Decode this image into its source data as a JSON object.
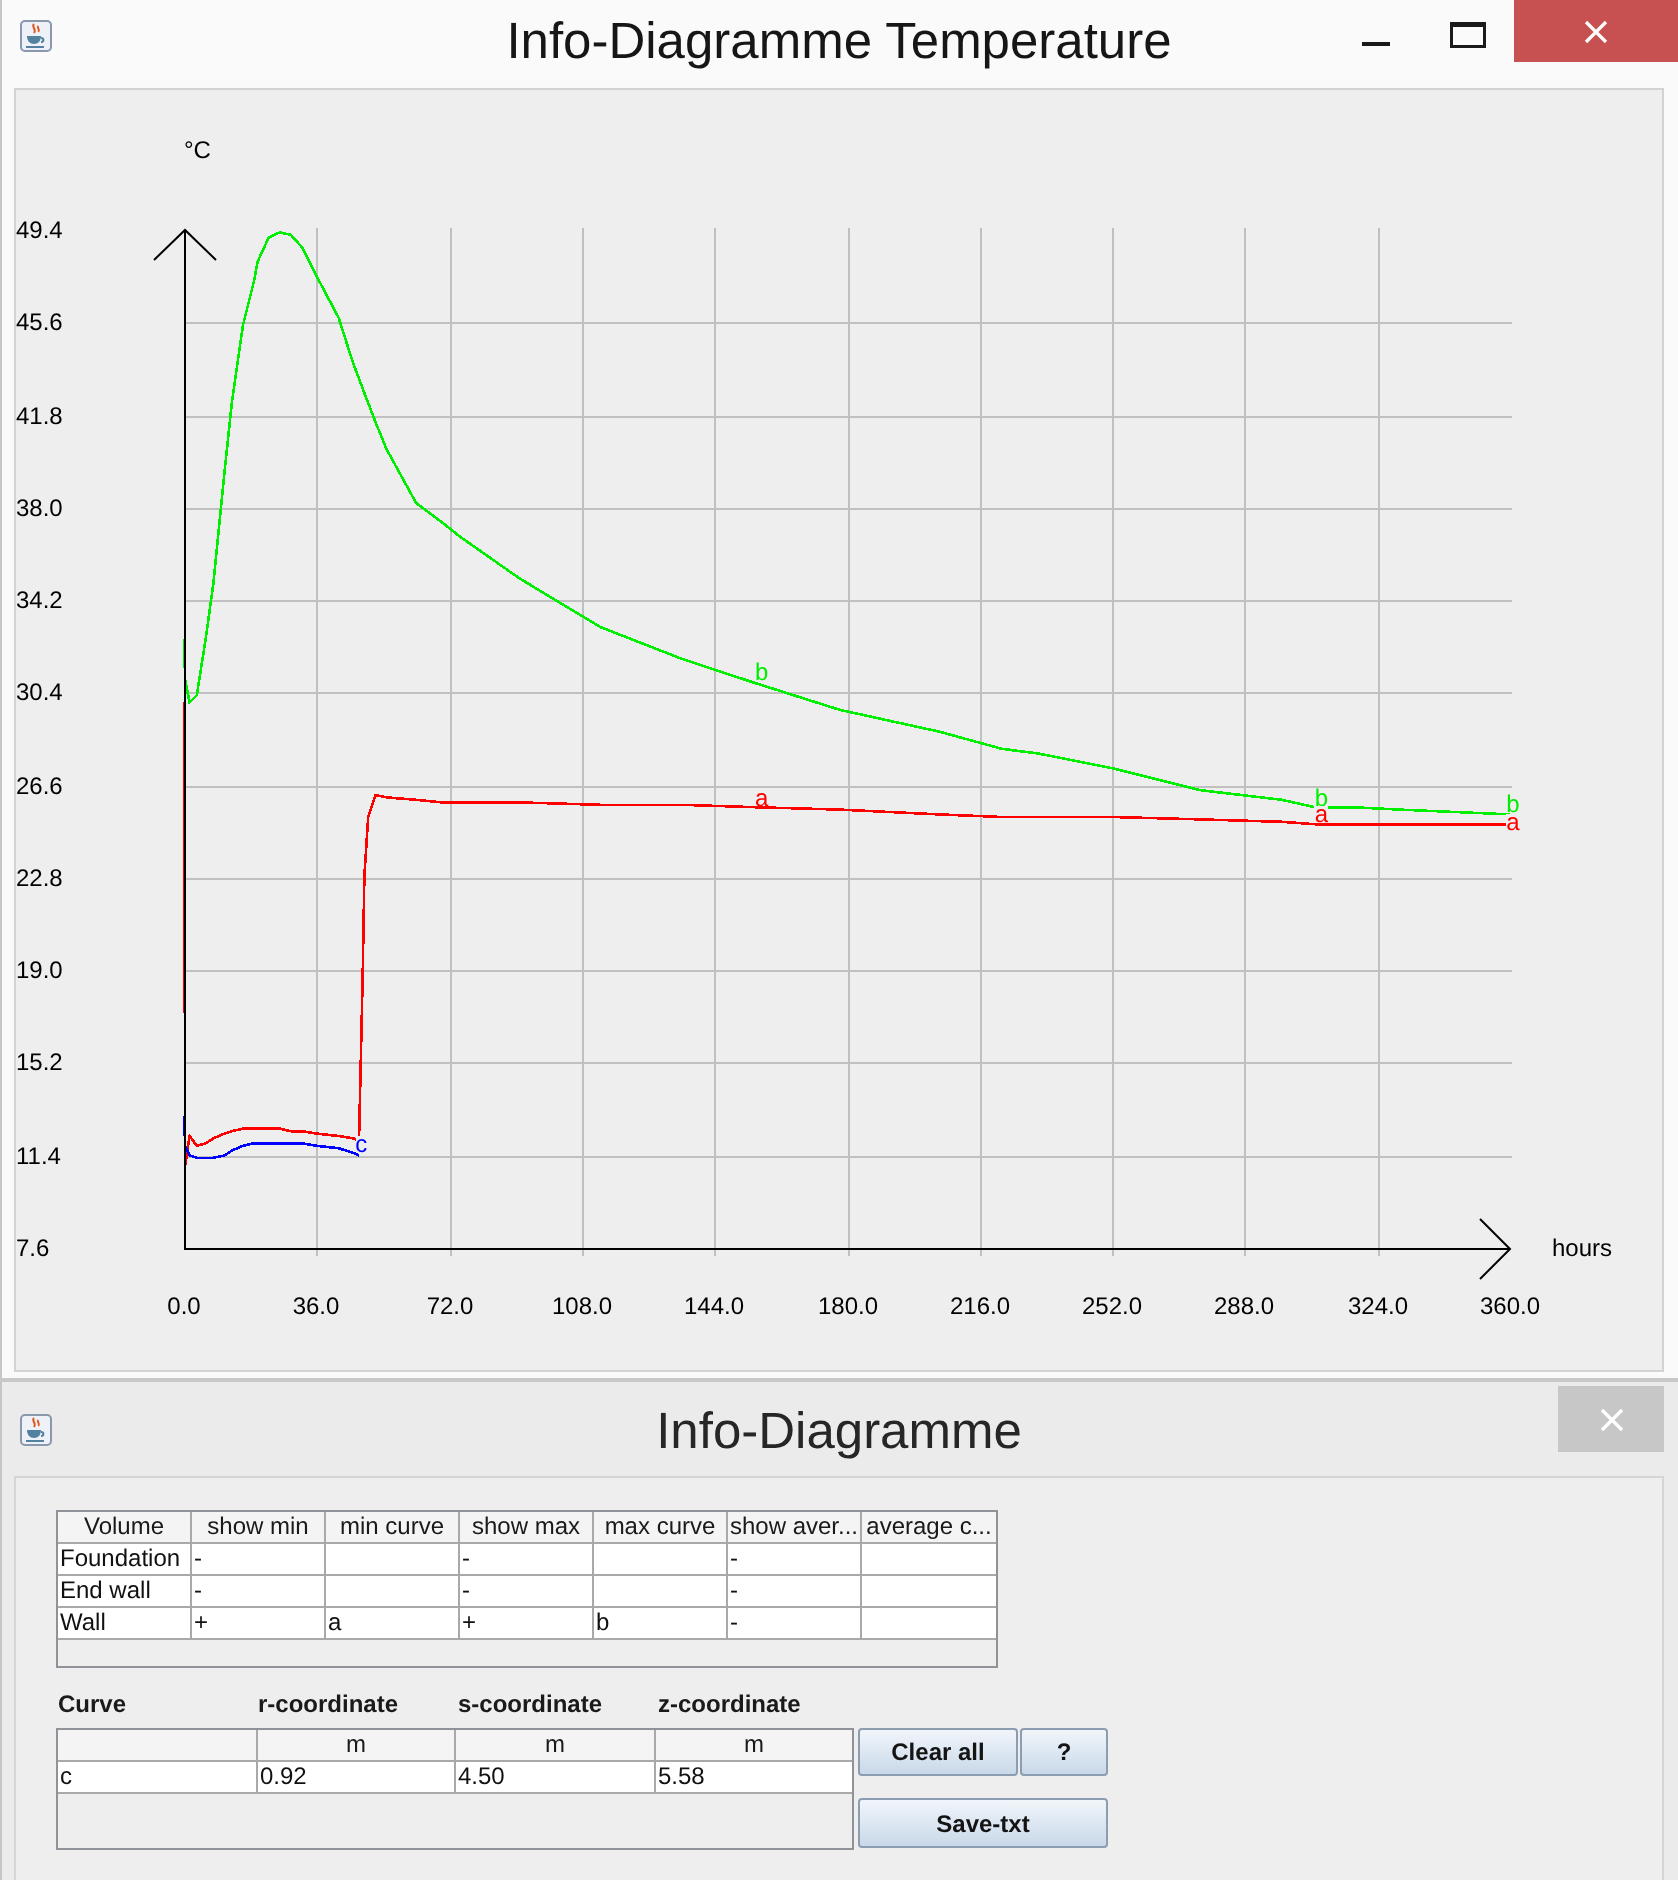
{
  "window": {
    "title": "Info-Diagramme Temperature"
  },
  "chart": {
    "chart_data": {
      "type": "line",
      "grid": true,
      "xlabel": "hours",
      "ylabel": "°C",
      "x": [
        0,
        0.3,
        1.5,
        3.5,
        6,
        8,
        11,
        13,
        16,
        19,
        20,
        23,
        26,
        29,
        32,
        36,
        42,
        46,
        47.5,
        48.5,
        49,
        50,
        52,
        55,
        63,
        70,
        75,
        91,
        113,
        135,
        155,
        178,
        205,
        222,
        232,
        252,
        276,
        298,
        307,
        317,
        330,
        360
      ],
      "series": [
        {
          "color": "#ff0000",
          "values": [
            30.0,
            11.0,
            12.2,
            11.8,
            11.9,
            12.1,
            12.3,
            12.4,
            12.5,
            12.5,
            12.5,
            12.5,
            12.5,
            12.4,
            12.4,
            12.3,
            12.2,
            12.1,
            12.0,
            18.6,
            22.9,
            25.3,
            26.2,
            26.1,
            26.0,
            25.9,
            25.9,
            25.9,
            25.8,
            25.8,
            25.7,
            25.6,
            25.4,
            25.3,
            25.3,
            25.3,
            25.2,
            25.1,
            25.0,
            25.0,
            25.0,
            25.0
          ]
        },
        {
          "color": "#00ee00",
          "values": [
            32.6,
            30.9,
            30.0,
            30.3,
            32.7,
            34.9,
            39.5,
            42.3,
            45.5,
            47.3,
            48.1,
            49.1,
            49.3,
            49.2,
            48.7,
            47.5,
            45.8,
            43.9,
            43.3,
            42.9,
            42.7,
            42.3,
            41.5,
            40.4,
            38.2,
            37.4,
            36.8,
            35.1,
            33.1,
            31.8,
            30.8,
            29.7,
            28.8,
            28.1,
            27.9,
            27.3,
            26.4,
            26.0,
            25.7,
            25.7,
            25.6,
            25.4
          ]
        },
        {
          "color": "#0000ff",
          "values": [
            13.0,
            11.8,
            11.4,
            11.3,
            11.3,
            11.3,
            11.4,
            11.6,
            11.8,
            11.9,
            11.9,
            11.9,
            11.9,
            11.9,
            11.9,
            11.8,
            11.7,
            11.5,
            11.4,
            null,
            null,
            null,
            null,
            null,
            null,
            null,
            null,
            null,
            null,
            null,
            null,
            null,
            null,
            null,
            null,
            null,
            null,
            null,
            null,
            null,
            null,
            null
          ]
        }
      ],
      "xlim": [
        0,
        360
      ],
      "ylim": [
        7.6,
        49.4
      ],
      "xticks": [
        {
          "value": 0,
          "label": "0.0"
        },
        {
          "value": 36,
          "label": "36.0"
        },
        {
          "value": 72,
          "label": "72.0"
        },
        {
          "value": 108,
          "label": "108.0"
        },
        {
          "value": 144,
          "label": "144.0"
        },
        {
          "value": 180,
          "label": "180.0"
        },
        {
          "value": 216,
          "label": "216.0"
        },
        {
          "value": 252,
          "label": "252.0"
        },
        {
          "value": 288,
          "label": "288.0"
        },
        {
          "value": 324,
          "label": "324.0"
        },
        {
          "value": 360,
          "label": "360.0"
        }
      ],
      "yticks": [
        {
          "value": 7.6,
          "label": "7.6"
        },
        {
          "value": 11.4,
          "label": "11.4"
        },
        {
          "value": 15.2,
          "label": "15.2"
        },
        {
          "value": 19.0,
          "label": "19.0"
        },
        {
          "value": 22.8,
          "label": "22.8"
        },
        {
          "value": 26.6,
          "label": "26.6"
        },
        {
          "value": 30.4,
          "label": "30.4"
        },
        {
          "value": 34.2,
          "label": "34.2"
        },
        {
          "value": 38.0,
          "label": "38.0"
        },
        {
          "value": 41.8,
          "label": "41.8"
        },
        {
          "value": 45.6,
          "label": "45.6"
        },
        {
          "value": 49.4,
          "label": "49.4"
        }
      ],
      "annotations": [
        {
          "text": "b",
          "x": 155,
          "y": 30.8
        },
        {
          "text": "a",
          "x": 155,
          "y": 25.7
        },
        {
          "text": "b",
          "x": 307,
          "y": 25.7
        },
        {
          "text": "a",
          "x": 307,
          "y": 25.0
        },
        {
          "text": "b",
          "x": 359,
          "y": 25.4
        },
        {
          "text": "a",
          "x": 359,
          "y": 24.7
        },
        {
          "text": "c",
          "x": 46.5,
          "y": 11.5
        }
      ]
    }
  },
  "info_window": {
    "title": "Info-Diagramme",
    "volume_table": {
      "columns": [
        "Volume",
        "show min",
        "min curve",
        "show max",
        "max curve",
        "show aver...",
        "average c..."
      ],
      "rows": [
        {
          "volume": "Foundation",
          "show_min": "-",
          "show_max": "-",
          "show_aver": "-"
        },
        {
          "volume": "End wall",
          "show_min": "-",
          "show_max": "-",
          "show_aver": "-"
        },
        {
          "volume": "Wall",
          "show_min": "+",
          "min_curve": "a",
          "show_max": "+",
          "max_curve": "b",
          "show_aver": "-"
        }
      ]
    },
    "coordinate_table": {
      "columns": [
        {
          "label": "Curve"
        },
        {
          "label": "r-coordinate",
          "unit": "m"
        },
        {
          "label": "s-coordinate",
          "unit": "m"
        },
        {
          "label": "z-coordinate",
          "unit": "m"
        }
      ],
      "rows": [
        [
          "c",
          "0.92",
          "4.50",
          "5.58"
        ]
      ]
    },
    "buttons": [
      {
        "label": "Clear all"
      },
      {
        "label": "?"
      },
      {
        "label": "Save-txt"
      }
    ]
  }
}
